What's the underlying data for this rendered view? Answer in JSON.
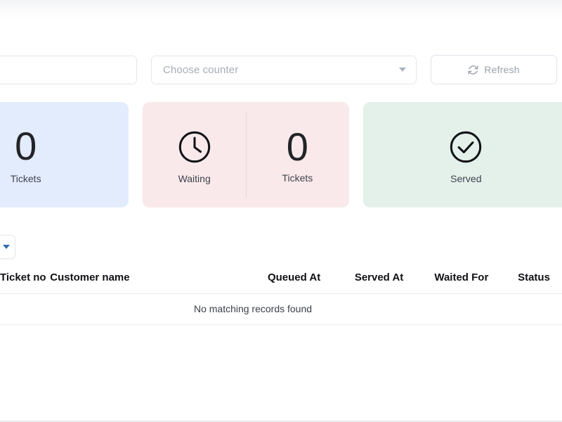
{
  "toolbar": {
    "search_value": "",
    "search_placeholder": "",
    "counter_select_label": "Choose counter",
    "refresh_label": "Refresh",
    "refresh_icon": "refresh-icon",
    "chevron_icon": "chevron-down-icon"
  },
  "cards": [
    {
      "id": "tickets-total",
      "color": "#e3ecfd",
      "panels": [
        {
          "kind": "number",
          "value": "0",
          "label": "Tickets"
        }
      ]
    },
    {
      "id": "waiting-tickets",
      "color": "#f9e9eb",
      "panels": [
        {
          "kind": "icon",
          "icon": "clock-icon",
          "label": "Waiting"
        },
        {
          "kind": "number",
          "value": "0",
          "label": "Tickets"
        }
      ]
    },
    {
      "id": "served",
      "color": "#e4f0ea",
      "panels": [
        {
          "kind": "icon",
          "icon": "check-circle-icon",
          "label": "Served"
        }
      ]
    }
  ],
  "length_menu": {
    "value": "",
    "caret_icon": "chevron-down-icon"
  },
  "table": {
    "columns": [
      "Ticket no",
      "Customer name",
      "Queued At",
      "Served At",
      "Waited For",
      "Status"
    ],
    "rows": [],
    "empty_message": "No matching records found"
  }
}
